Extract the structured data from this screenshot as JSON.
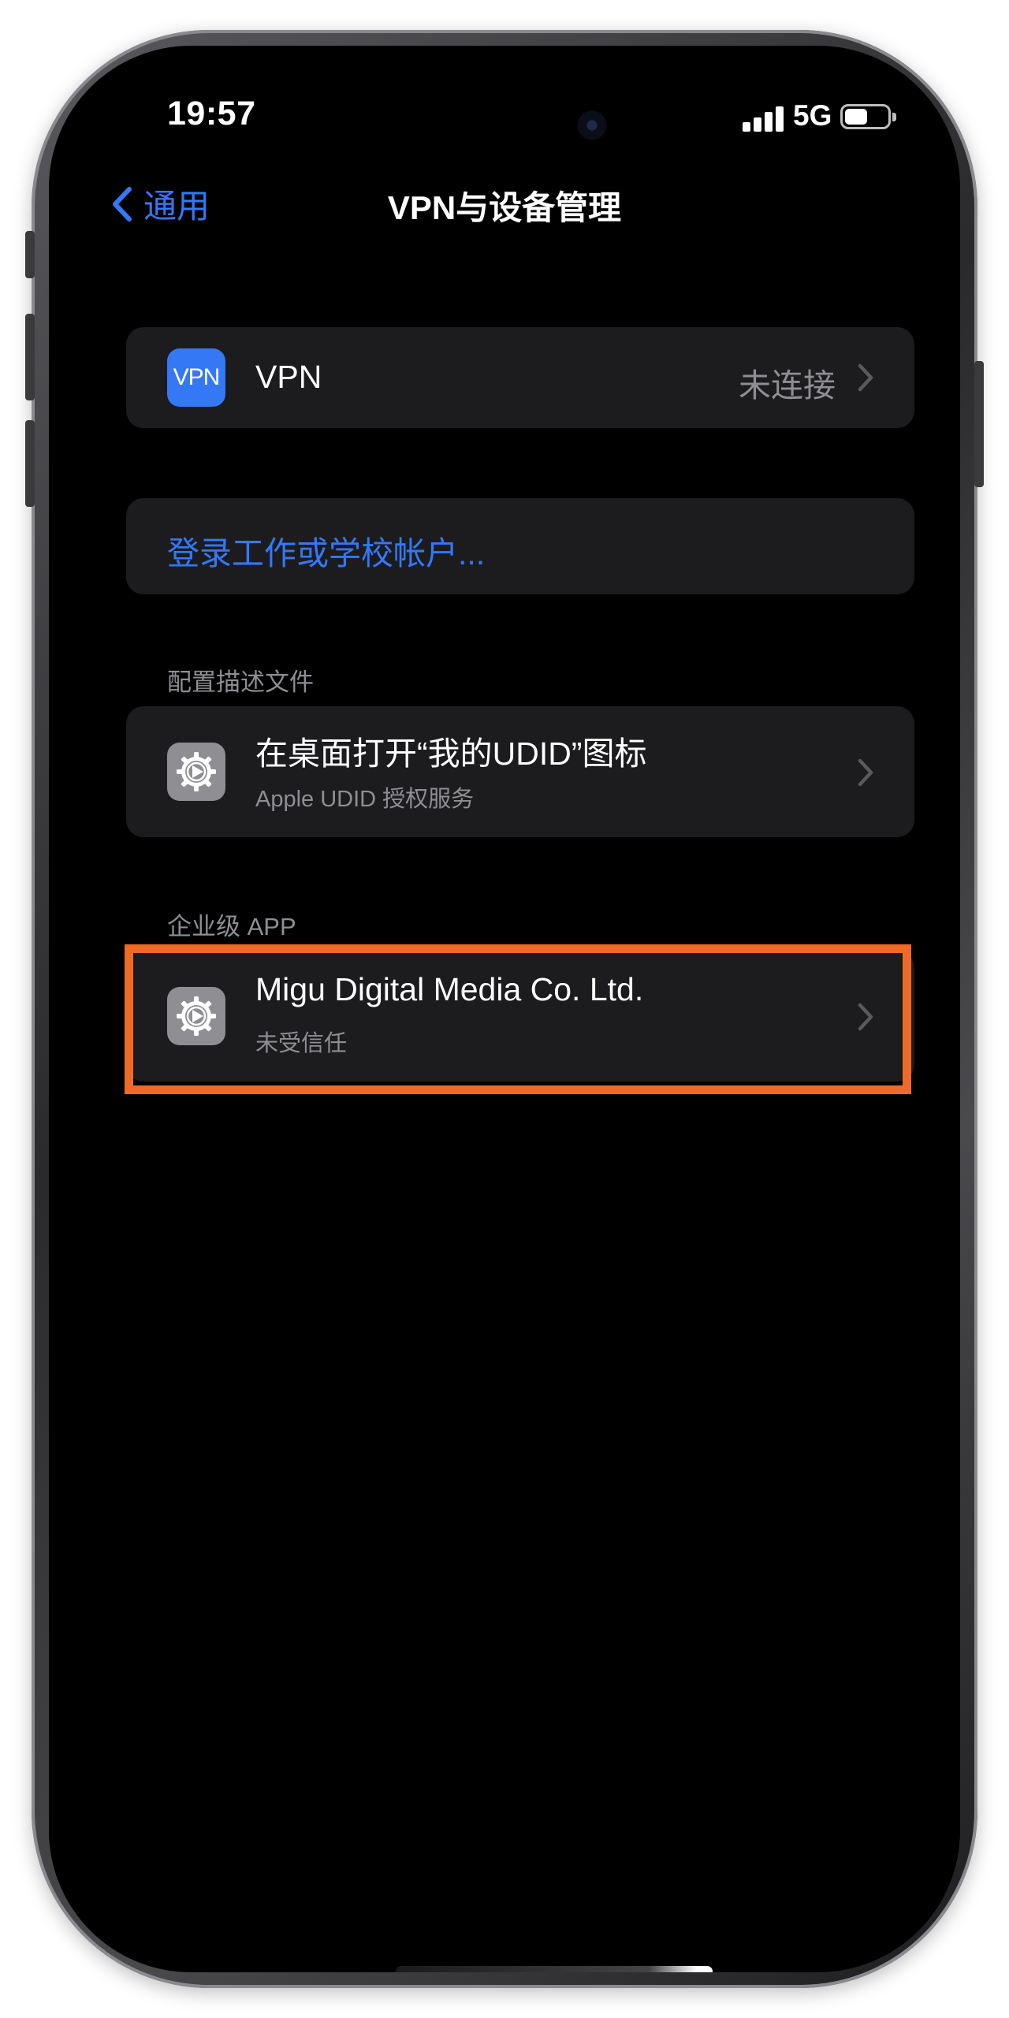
{
  "status_bar": {
    "time": "19:57",
    "network": "5G",
    "signal_bars": 4,
    "battery_level": 0.4
  },
  "nav": {
    "back_label": "通用",
    "title": "VPN与设备管理"
  },
  "vpn_row": {
    "icon_text": "VPN",
    "label": "VPN",
    "status": "未连接"
  },
  "signin_row": {
    "label": "登录工作或学校帐户..."
  },
  "profiles_section": {
    "header": "配置描述文件",
    "item": {
      "title": "在桌面打开“我的UDID”图标",
      "subtitle": "Apple UDID 授权服务"
    }
  },
  "enterprise_section": {
    "header": "企业级 APP",
    "item": {
      "title": "Migu Digital Media Co. Ltd.",
      "subtitle": "未受信任"
    }
  },
  "colors": {
    "accent": "#3478f6",
    "highlight_border": "#f06a27",
    "cell_background": "#1c1c1e",
    "secondary_text": "#8e8e93"
  }
}
